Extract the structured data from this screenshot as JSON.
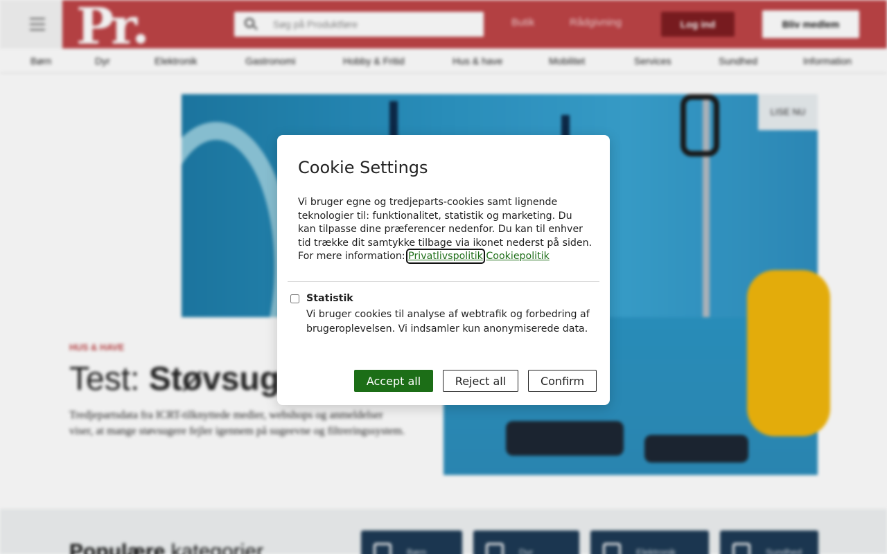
{
  "header": {
    "logo_text": "Pr",
    "search_placeholder": "Søg på Produktføre",
    "nav": [
      "Butik",
      "Rådgivning"
    ],
    "login_label": "Log ind",
    "member_label": "Bliv medlem"
  },
  "categories": [
    "Børn",
    "Dyr",
    "Elektronik",
    "Gastronomi",
    "Hobby & Fritid",
    "Hus & have",
    "Mobilitet",
    "Services",
    "Sundhed",
    "Information"
  ],
  "hero": {
    "badge": "LISE NU",
    "kicker": "HUS & HAVE",
    "headline_prefix": "Test: ",
    "headline_bold": "Støvsug",
    "lede": "Tredjepartsdata fra ICRT-tilknyttede medier, webshops og anmeldelser viser, at mange støvsugere fejler igennem på sugeevne og filtreringssystem."
  },
  "popular": {
    "heading_bold": "Populære",
    "heading_rest": " kategorier",
    "tiles": [
      "Børn",
      "Dyr",
      "Elektronik",
      "Sundhed"
    ]
  },
  "cookie_dialog": {
    "title": "Cookie Settings",
    "body": "Vi bruger egne og tredjeparts-cookies samt lignende teknologier til: funktionalitet, statistik og marketing. Du kan tilpasse dine præferencer nedenfor. Du kan til enhver tid trække dit samtykke tilbage via ikonet nederst på siden. For mere information: ",
    "link_privacy": "Privatlivspolitik",
    "link_cookie": "Cookiepolitik",
    "statistik_title": "Statistik",
    "statistik_desc": "Vi bruger cookies til analyse af webtrafik og forbedring af brugeroplevelsen. Vi indsamler kun anonymiserede data.",
    "statistik_checked": false,
    "accept_label": "Accept all",
    "reject_label": "Reject all",
    "confirm_label": "Confirm"
  },
  "colors": {
    "brand_red": "#bf4447",
    "accept_green": "#1c6e17",
    "link_green": "#1f6e19"
  }
}
